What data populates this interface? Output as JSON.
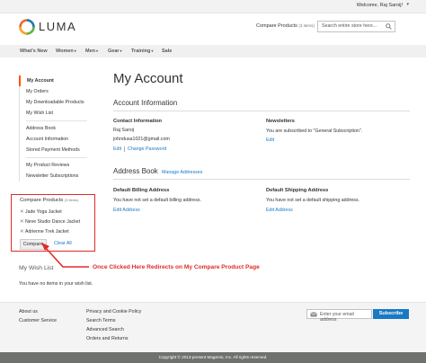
{
  "topbar": {
    "welcome": "Welcome, Raj Saroij!"
  },
  "header": {
    "logo": "LUMA",
    "compare_link": "Compare Products",
    "compare_count": "(3 items)",
    "search_placeholder": "Search entire store here..."
  },
  "nav": {
    "items": [
      "What's New",
      "Women",
      "Men",
      "Gear",
      "Training",
      "Sale"
    ]
  },
  "sidebar": {
    "group1": [
      "My Account",
      "My Orders",
      "My Downloadable Products",
      "My Wish List"
    ],
    "group2": [
      "Address Book",
      "Account Information",
      "Stored Payment Methods"
    ],
    "group3": [
      "My Product Reviews",
      "Newsletter Subscriptions"
    ]
  },
  "compare": {
    "title": "Compare Products",
    "count": "(3 items)",
    "items": [
      "Jade Yoga Jacket",
      "Neve Studio Dance Jacket",
      "Adrienne Trek Jacket"
    ],
    "compare_button": "Compare",
    "clear_all": "Clear All"
  },
  "wishlist": {
    "title": "My Wish List",
    "empty": "You have no items in your wish list."
  },
  "main": {
    "title": "My Account",
    "account_info": {
      "title": "Account Information",
      "contact_title": "Contact Information",
      "name": "Raj Saroij",
      "email": "johndusa1021@gmail.com",
      "edit": "Edit",
      "change_password": "Change Password",
      "newsletters_title": "Newsletters",
      "newsletters_text": "You are subscribed to \"General Subscription\".",
      "newsletters_edit": "Edit"
    },
    "address_book": {
      "title": "Address Book",
      "manage": "Manage Addresses",
      "billing_title": "Default Billing Address",
      "billing_text": "You have not set a default billing address.",
      "billing_edit": "Edit Address",
      "shipping_title": "Default Shipping Address",
      "shipping_text": "You have not set a default shipping address.",
      "shipping_edit": "Edit Address"
    }
  },
  "annotation": {
    "text": "Once Clicked Here Redirects on My Compare Product Page",
    "color": "#e02b27"
  },
  "footer": {
    "col1": [
      "About us",
      "Customer Service"
    ],
    "col2": [
      "Privacy and Cookie Policy",
      "Search Terms",
      "Advanced Search",
      "Orders and Returns"
    ],
    "newsletter_placeholder": "Enter your email address",
    "subscribe": "Subscribe",
    "copyright": "Copyright © 2013-present Magento, Inc. All rights reserved."
  },
  "colors": {
    "accent": "#ff5501",
    "link": "#1979c3",
    "button": "#1979c3"
  }
}
